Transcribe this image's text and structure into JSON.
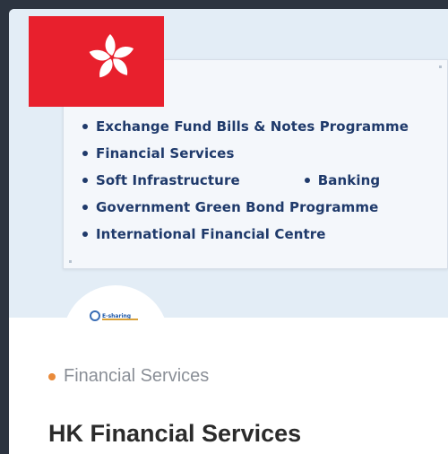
{
  "hero": {
    "list": [
      "Exchange Fund Bills & Notes Programme",
      "Financial Services",
      "Soft Infrastructure",
      "Banking",
      "Government Green Bond Programme",
      "International Financial Centre"
    ]
  },
  "logo": {
    "text": "E-sharing"
  },
  "article": {
    "category": "Financial Services",
    "title": "HK Financial Services"
  },
  "colors": {
    "flag_red": "#e8202d",
    "list_navy": "#1f3a6b",
    "category_dot": "#e98a3a"
  },
  "icons": [
    "bauhinia-flag-icon",
    "bullet-icon",
    "e-sharing-logo"
  ]
}
